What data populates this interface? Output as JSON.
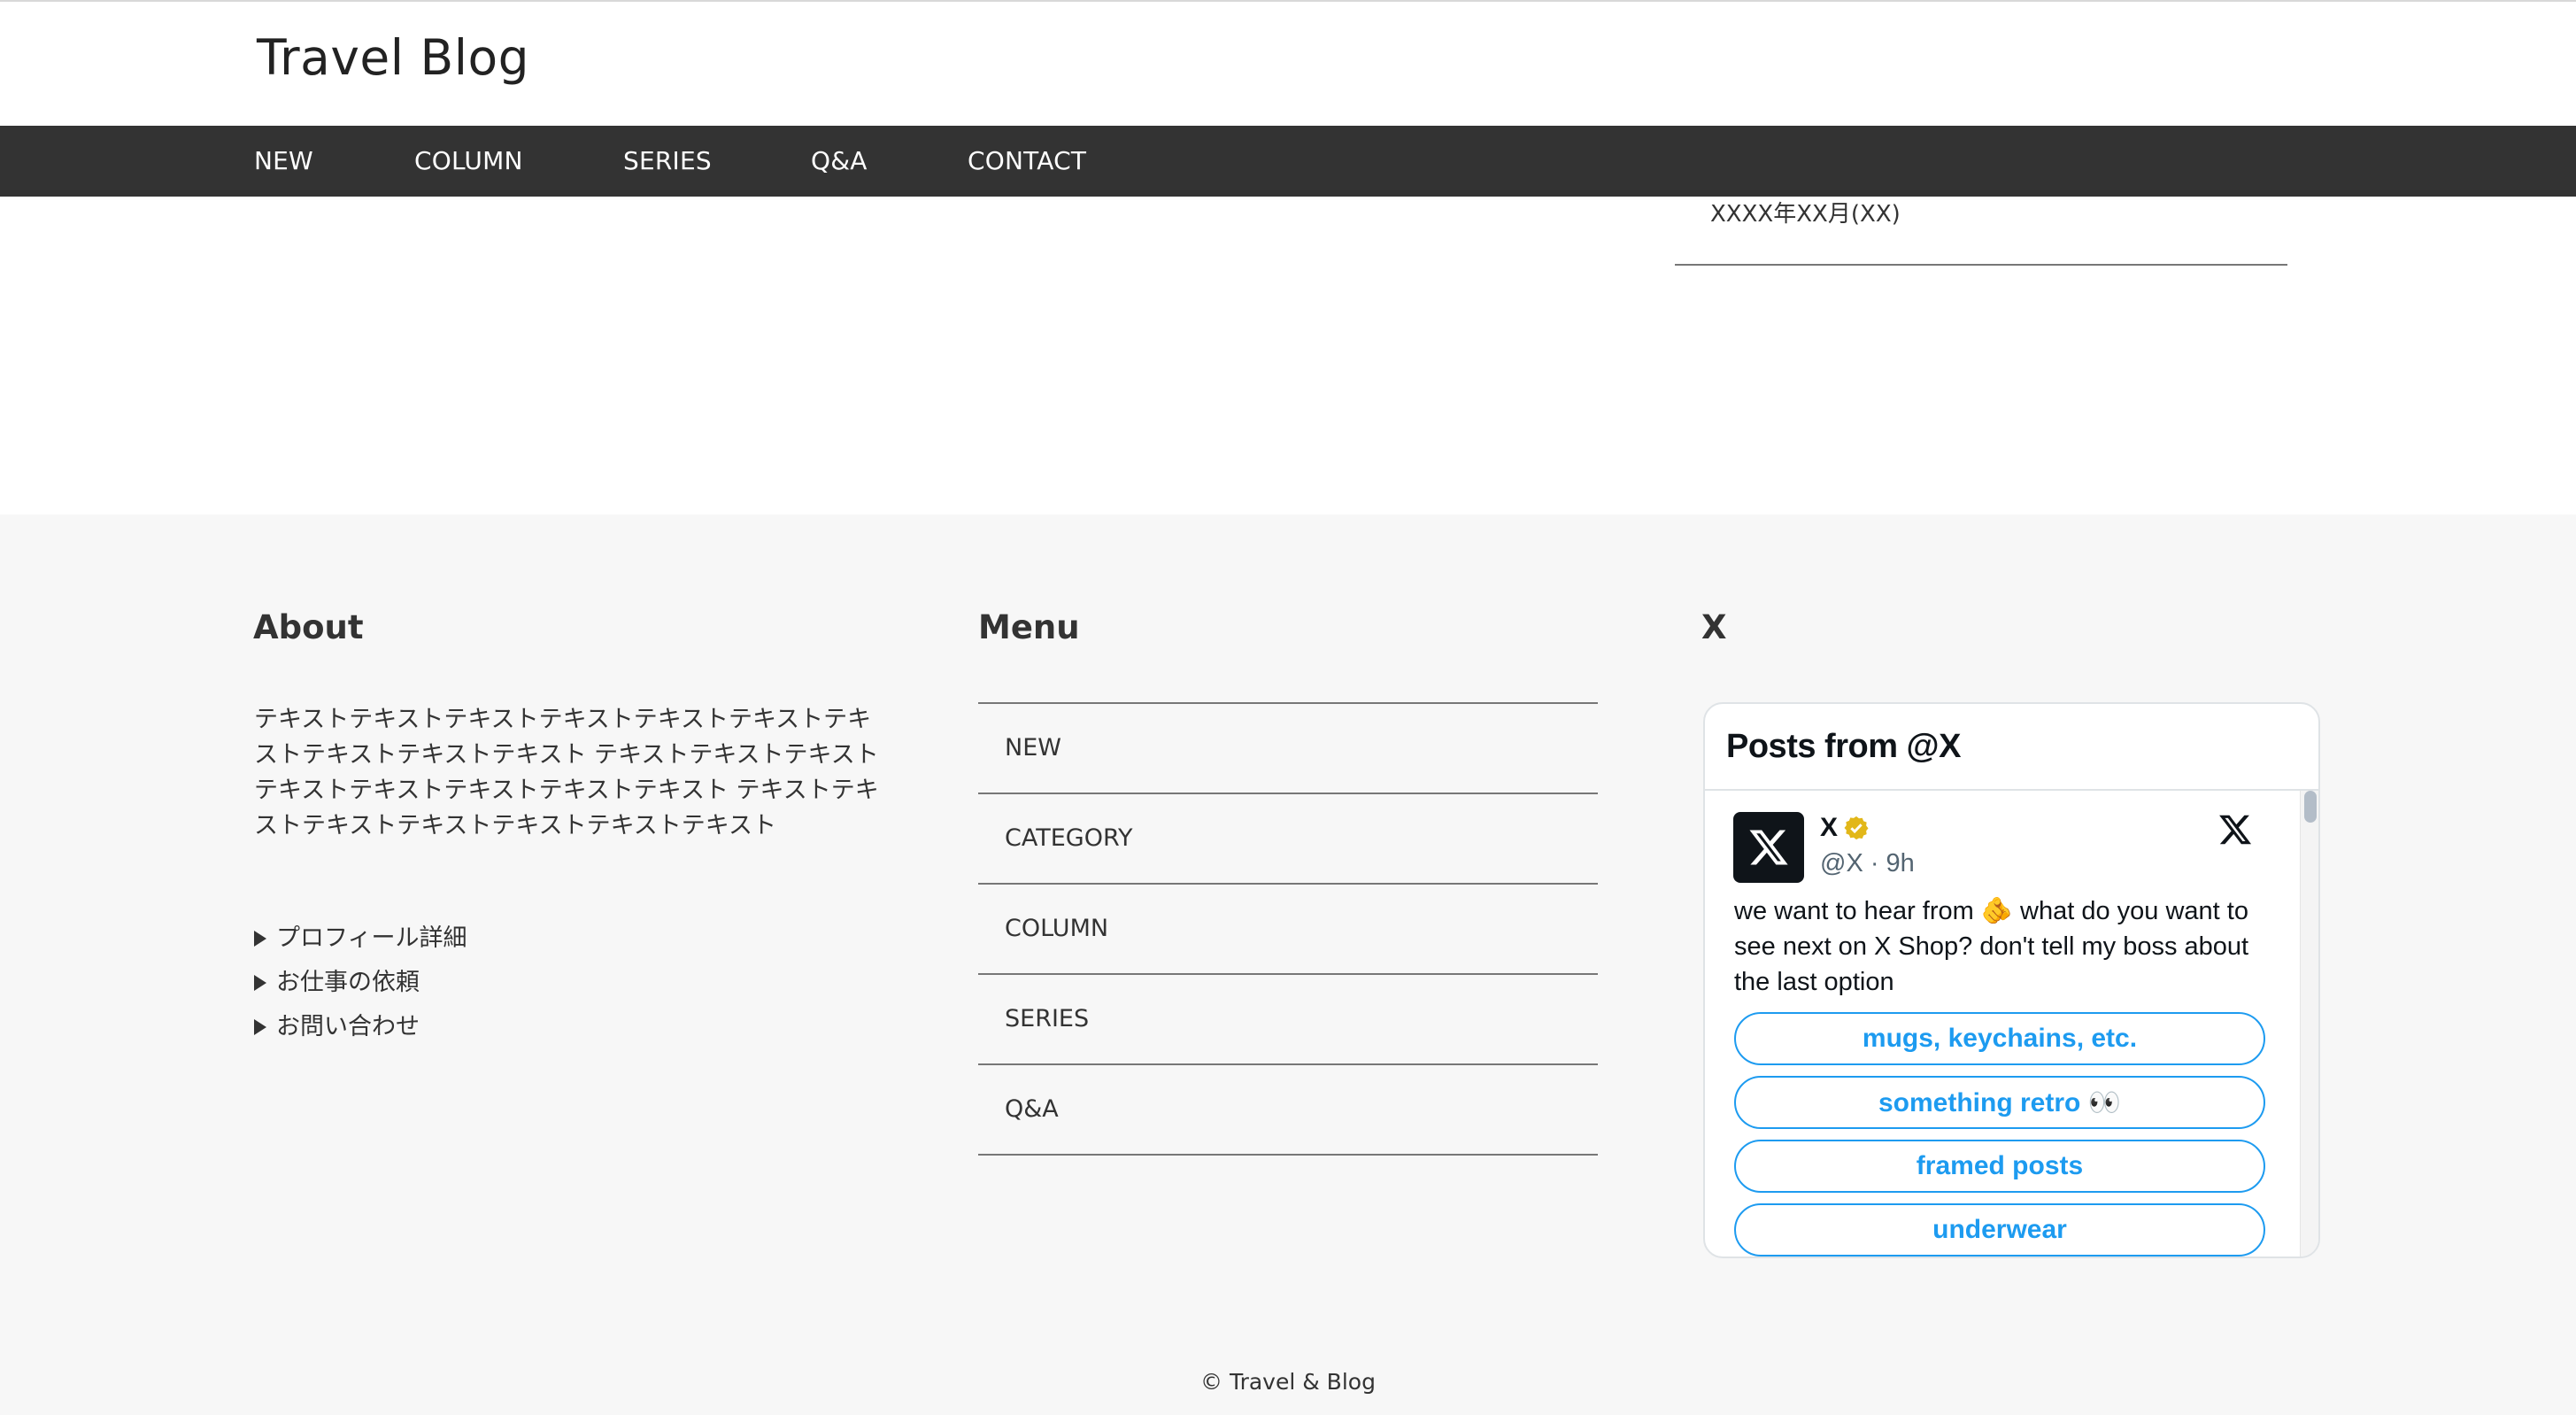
{
  "header": {
    "site_title": "Travel Blog"
  },
  "nav": {
    "items": [
      {
        "label": "NEW"
      },
      {
        "label": "COLUMN"
      },
      {
        "label": "SERIES"
      },
      {
        "label": "Q&A"
      },
      {
        "label": "CONTACT"
      }
    ]
  },
  "main": {
    "date": "XXXX年XX月(XX)"
  },
  "footer": {
    "about": {
      "heading": "About",
      "text": "テキストテキストテキストテキストテキストテキストテキストテキストテキストテキスト テキストテキストテキストテキストテキストテキストテキストテキスト テキストテキストテキストテキストテキストテキストテキスト",
      "links": [
        {
          "label": "プロフィール詳細"
        },
        {
          "label": "お仕事の依頼"
        },
        {
          "label": "お問い合わせ"
        }
      ]
    },
    "menu": {
      "heading": "Menu",
      "items": [
        {
          "label": "NEW"
        },
        {
          "label": "CATEGORY"
        },
        {
          "label": "COLUMN"
        },
        {
          "label": "SERIES"
        },
        {
          "label": "Q&A"
        }
      ]
    },
    "x": {
      "heading": "X",
      "widget": {
        "title": "Posts from @X",
        "post": {
          "account_name": "X",
          "verified_icon": "verified-badge-icon",
          "handle_time": "@X · 9h",
          "text": "we want to hear from 🫵 what do you want to see next on X Shop? don't tell my boss about the last option",
          "poll_options": [
            {
              "label": "mugs, keychains, etc."
            },
            {
              "label": "something retro 👀"
            },
            {
              "label": "framed posts"
            },
            {
              "label": "underwear"
            }
          ]
        },
        "accent_color": "#1d9bf0"
      }
    },
    "copyright": "© Travel & Blog"
  }
}
